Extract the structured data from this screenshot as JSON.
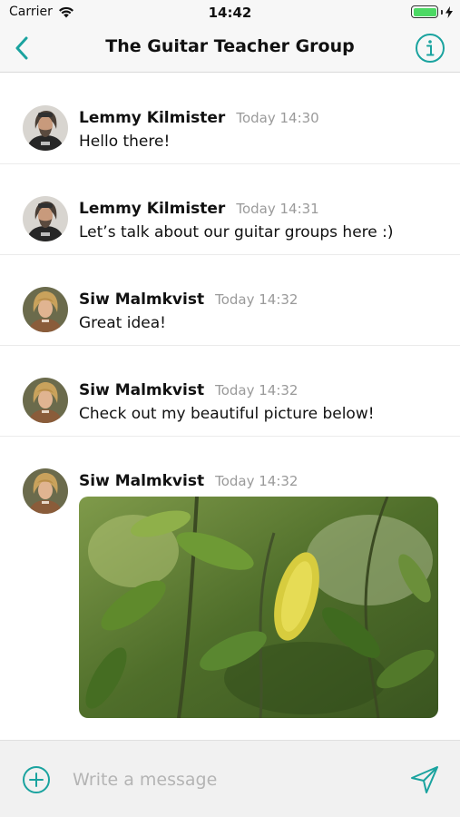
{
  "status_bar": {
    "carrier": "Carrier",
    "time": "14:42"
  },
  "nav": {
    "title": "The Guitar Teacher Group"
  },
  "colors": {
    "accent": "#1aa39f",
    "battery": "#4cd964"
  },
  "messages": [
    {
      "sender": "Lemmy Kilmister",
      "time": "Today 14:30",
      "text": "Hello there!"
    },
    {
      "sender": "Lemmy Kilmister",
      "time": "Today 14:31",
      "text": "Let’s talk about our guitar groups here :)"
    },
    {
      "sender": "Siw Malmkvist",
      "time": "Today 14:32",
      "text": "Great idea!"
    },
    {
      "sender": "Siw Malmkvist",
      "time": "Today 14:32",
      "text": "Check out my beautiful picture below!"
    },
    {
      "sender": "Siw Malmkvist",
      "time": "Today 14:32",
      "text": ""
    }
  ],
  "composer": {
    "placeholder": "Write a message",
    "value": ""
  },
  "icons": {
    "back": "chevron-left-icon",
    "info": "info-icon",
    "add": "plus-circle-icon",
    "send": "send-icon",
    "wifi": "wifi-icon",
    "battery": "battery-icon",
    "charging": "bolt-icon"
  }
}
